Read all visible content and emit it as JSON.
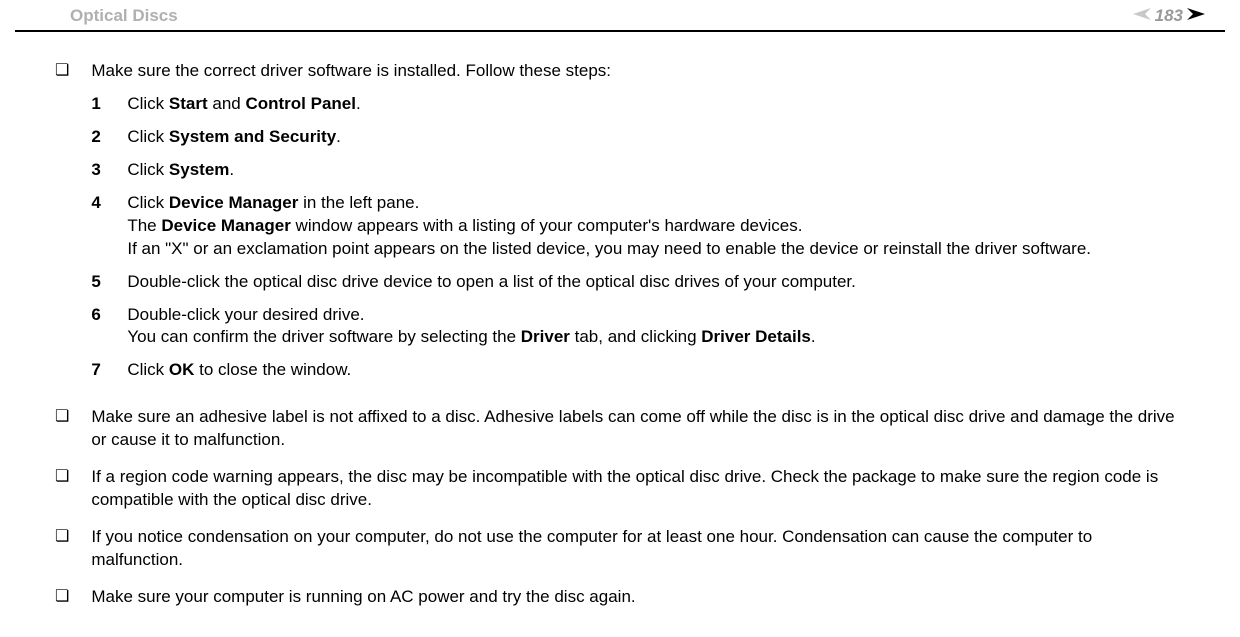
{
  "header": {
    "section_title": "Optical Discs",
    "page_number": "183"
  },
  "bullet1": {
    "intro": "Make sure the correct driver software is installed. Follow these steps:",
    "steps": [
      {
        "num": "1",
        "t1": "Click ",
        "b1": "Start",
        "t2": " and ",
        "b2": "Control Panel",
        "t3": "."
      },
      {
        "num": "2",
        "t1": "Click ",
        "b1": "System and Security",
        "t2": "."
      },
      {
        "num": "3",
        "t1": "Click ",
        "b1": "System",
        "t2": "."
      },
      {
        "num": "4",
        "t1": "Click ",
        "b1": "Device Manager",
        "t2": " in the left pane.",
        "line2a": "The ",
        "line2b": "Device Manager",
        "line2c": " window appears with a listing of your computer's hardware devices.",
        "line3": "If an \"X\" or an exclamation point appears on the listed device, you may need to enable the device or reinstall the driver software."
      },
      {
        "num": "5",
        "t1": "Double-click the optical disc drive device to open a list of the optical disc drives of your computer."
      },
      {
        "num": "6",
        "t1": "Double-click your desired drive.",
        "line2a": "You can confirm the driver software by selecting the ",
        "line2b": "Driver",
        "line2c": " tab, and clicking ",
        "line2d": "Driver Details",
        "line2e": "."
      },
      {
        "num": "7",
        "t1": "Click ",
        "b1": "OK",
        "t2": " to close the window."
      }
    ]
  },
  "bullet2": "Make sure an adhesive label is not affixed to a disc. Adhesive labels can come off while the disc is in the optical disc drive and damage the drive or cause it to malfunction.",
  "bullet3": "If a region code warning appears, the disc may be incompatible with the optical disc drive. Check the package to make sure the region code is compatible with the optical disc drive.",
  "bullet4": "If you notice condensation on your computer, do not use the computer for at least one hour. Condensation can cause the computer to malfunction.",
  "bullet5": "Make sure your computer is running on AC power and try the disc again."
}
